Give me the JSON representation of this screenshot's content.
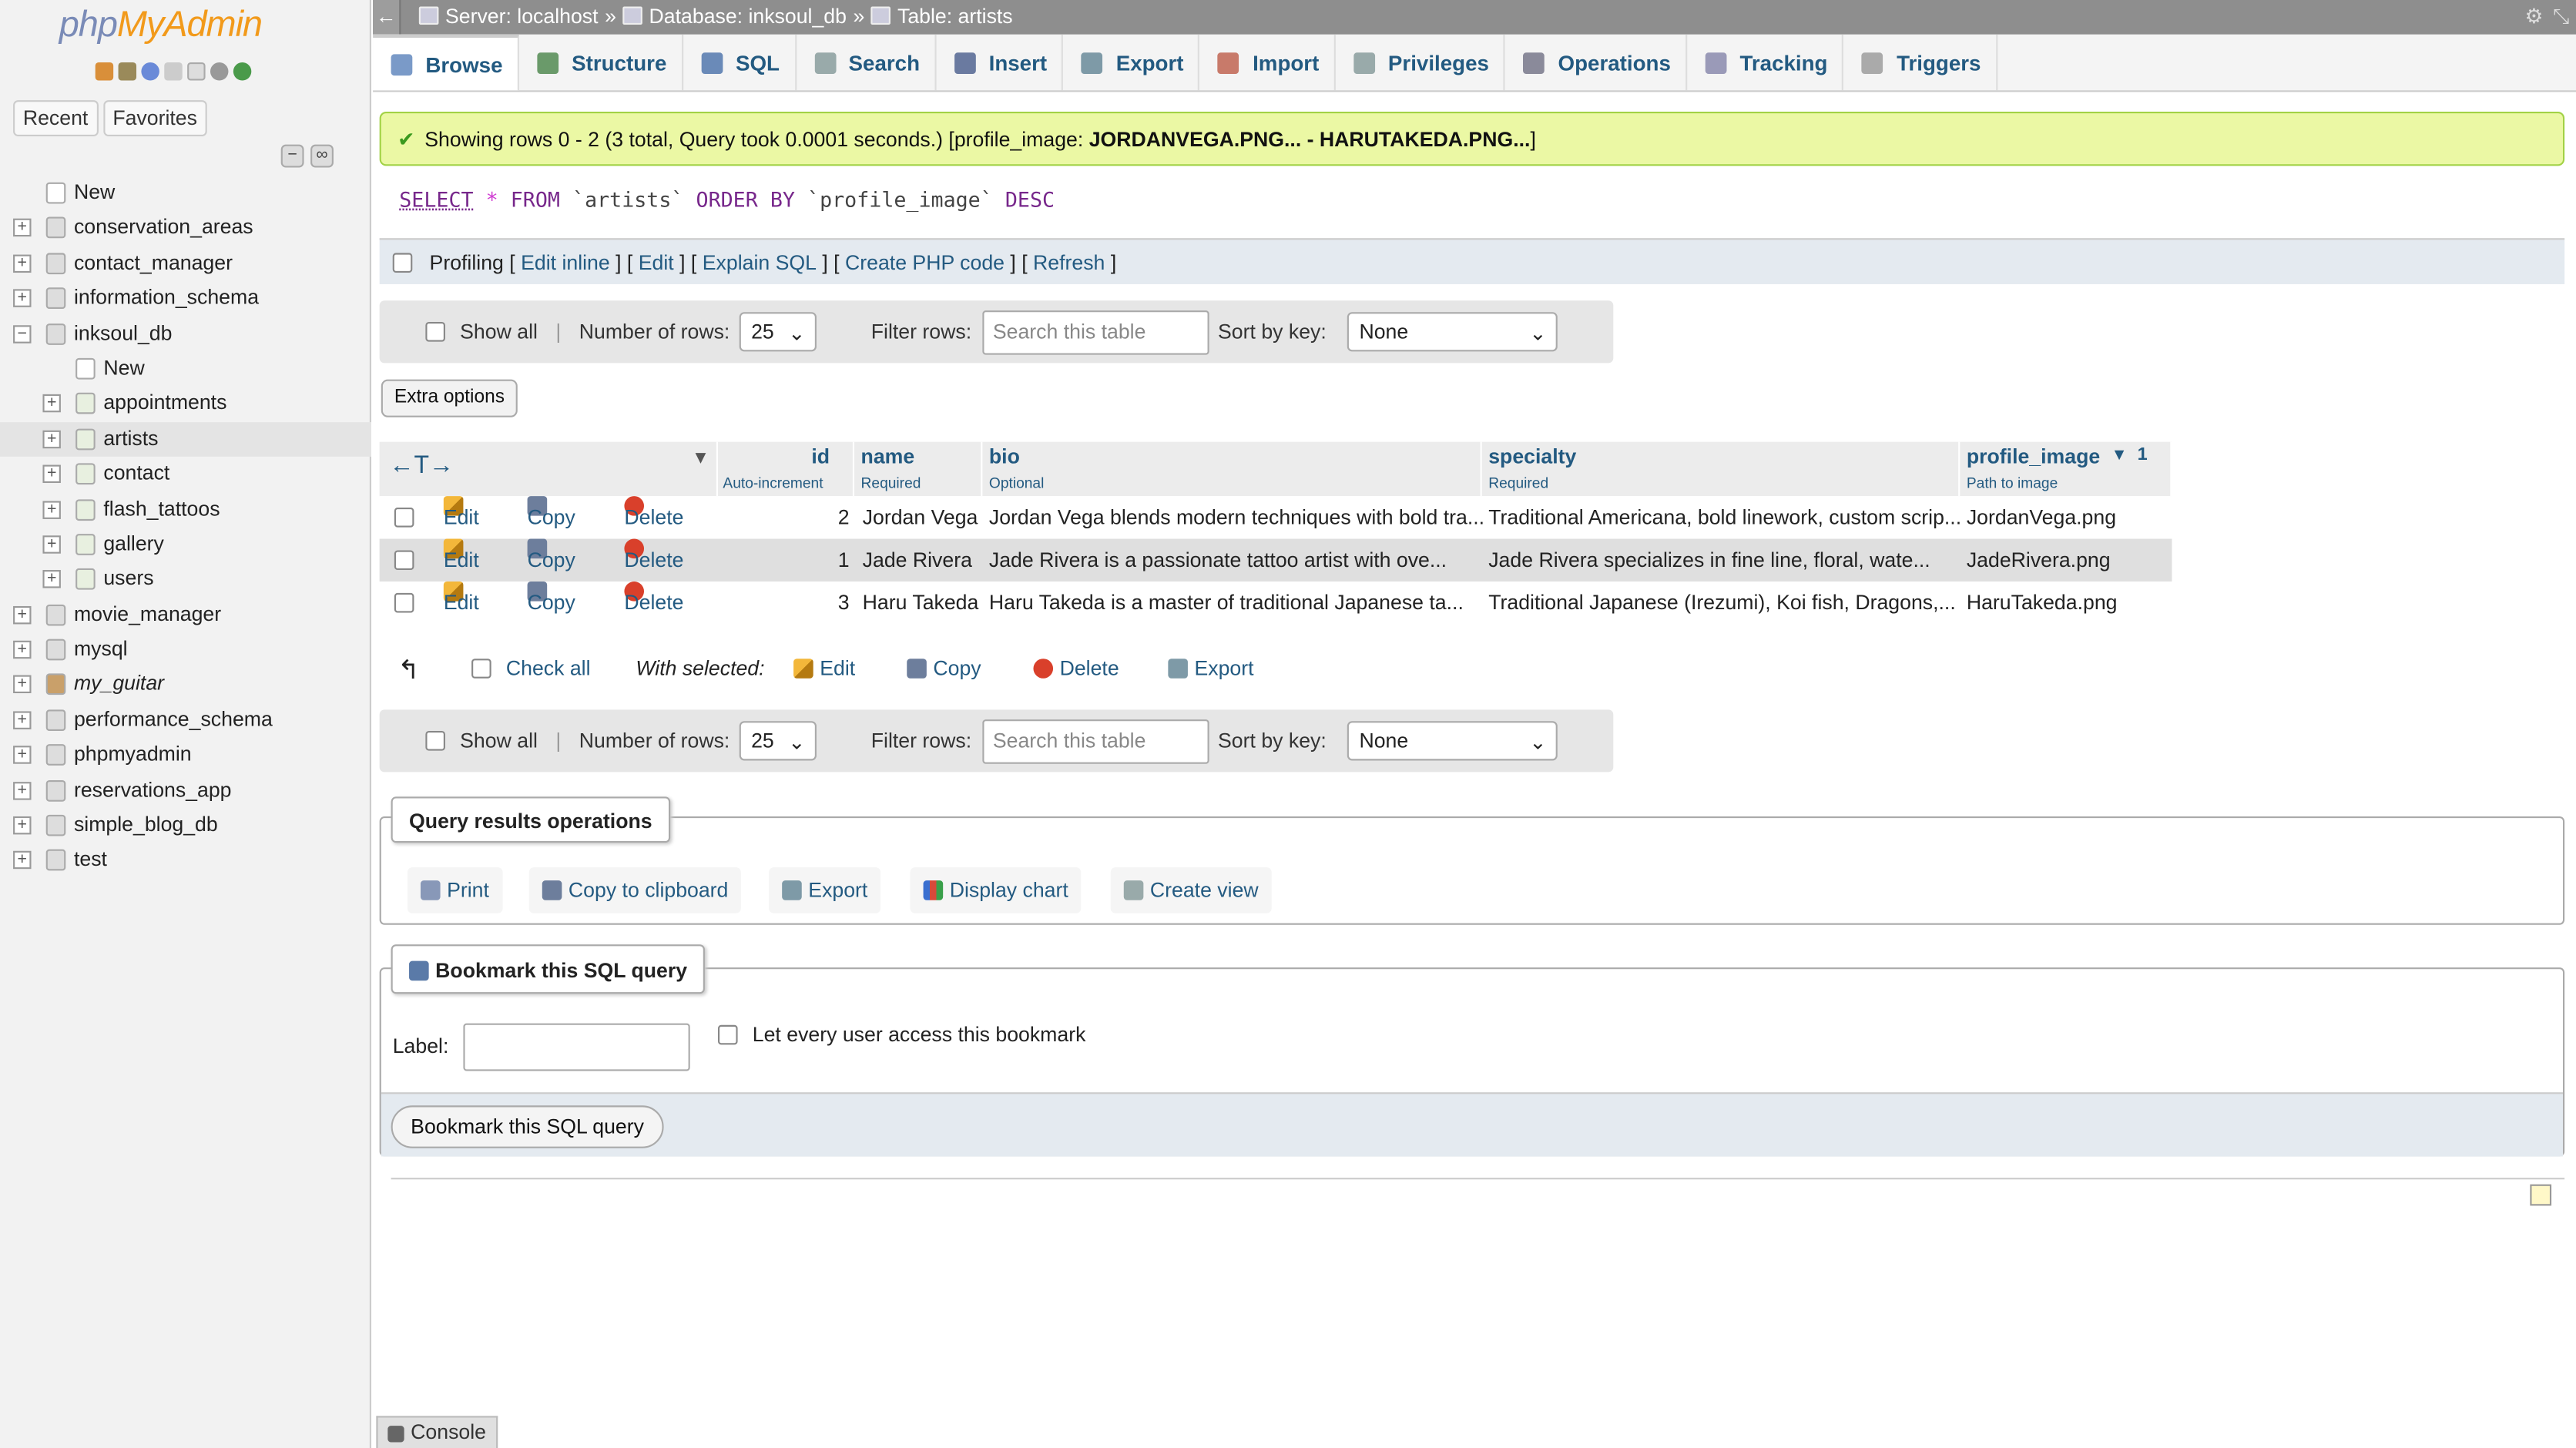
{
  "logo": {
    "part1": "php",
    "part2": "MyAdmin"
  },
  "nav": {
    "tab_recent": "Recent",
    "tab_favorites": "Favorites",
    "tree": [
      {
        "label": "New",
        "level": 0,
        "type": "new"
      },
      {
        "label": "conservation_areas",
        "level": 0,
        "type": "db"
      },
      {
        "label": "contact_manager",
        "level": 0,
        "type": "db"
      },
      {
        "label": "information_schema",
        "level": 0,
        "type": "db"
      },
      {
        "label": "inksoul_db",
        "level": 0,
        "type": "db",
        "expanded": true
      },
      {
        "label": "New",
        "level": 1,
        "type": "new"
      },
      {
        "label": "appointments",
        "level": 1,
        "type": "table"
      },
      {
        "label": "artists",
        "level": 1,
        "type": "table",
        "selected": true
      },
      {
        "label": "contact",
        "level": 1,
        "type": "table"
      },
      {
        "label": "flash_tattoos",
        "level": 1,
        "type": "table"
      },
      {
        "label": "gallery",
        "level": 1,
        "type": "table"
      },
      {
        "label": "users",
        "level": 1,
        "type": "table"
      },
      {
        "label": "movie_manager",
        "level": 0,
        "type": "db"
      },
      {
        "label": "mysql",
        "level": 0,
        "type": "db"
      },
      {
        "label": "my_guitar",
        "level": 0,
        "type": "db",
        "italic": true
      },
      {
        "label": "performance_schema",
        "level": 0,
        "type": "db"
      },
      {
        "label": "phpmyadmin",
        "level": 0,
        "type": "db"
      },
      {
        "label": "reservations_app",
        "level": 0,
        "type": "db"
      },
      {
        "label": "simple_blog_db",
        "level": 0,
        "type": "db"
      },
      {
        "label": "test",
        "level": 0,
        "type": "db"
      }
    ]
  },
  "breadcrumb": {
    "server": "Server: localhost",
    "database": "Database: inksoul_db",
    "table": "Table: artists",
    "sep": "»"
  },
  "tabs": [
    {
      "label": "Browse",
      "icon": "browse-icon",
      "active": true
    },
    {
      "label": "Structure",
      "icon": "structure-icon"
    },
    {
      "label": "SQL",
      "icon": "sql-icon"
    },
    {
      "label": "Search",
      "icon": "search-icon"
    },
    {
      "label": "Insert",
      "icon": "insert-icon"
    },
    {
      "label": "Export",
      "icon": "export-icon"
    },
    {
      "label": "Import",
      "icon": "import-icon"
    },
    {
      "label": "Privileges",
      "icon": "privileges-icon"
    },
    {
      "label": "Operations",
      "icon": "operations-icon"
    },
    {
      "label": "Tracking",
      "icon": "tracking-icon"
    },
    {
      "label": "Triggers",
      "icon": "triggers-icon"
    }
  ],
  "notice": {
    "text": "Showing rows 0 - 2 (3 total, Query took 0.0001 seconds.) [profile_image: ",
    "bold": "JORDANVEGA.PNG... - HARUTAKEDA.PNG...",
    "end": "]"
  },
  "sql": {
    "select": "SELECT",
    "star": "*",
    "from": "FROM",
    "table": "`artists`",
    "order": "ORDER BY",
    "col": "`profile_image`",
    "desc": "DESC"
  },
  "profiling": {
    "label": "Profiling",
    "edit_inline": "Edit inline",
    "edit": "Edit",
    "explain": "Explain SQL",
    "php": "Create PHP code",
    "refresh": "Refresh"
  },
  "navbar": {
    "show_all": "Show all",
    "num_rows_label": "Number of rows:",
    "num_rows": "25",
    "filter_label": "Filter rows:",
    "filter_placeholder": "Search this table",
    "sort_label": "Sort by key:",
    "sort_value": "None"
  },
  "extra_options": "Extra options",
  "columns": [
    {
      "name": "id",
      "sub": "Auto-increment"
    },
    {
      "name": "name",
      "sub": "Required"
    },
    {
      "name": "bio",
      "sub": "Optional"
    },
    {
      "name": "specialty",
      "sub": "Required"
    },
    {
      "name": "profile_image",
      "sub": "Path to image",
      "sort": "1"
    }
  ],
  "row_actions": {
    "edit": "Edit",
    "copy": "Copy",
    "delete": "Delete"
  },
  "rows": [
    {
      "id": "2",
      "name": "Jordan Vega",
      "bio": "Jordan Vega blends modern techniques with bold tra...",
      "specialty": "Traditional Americana, bold linework, custom scrip...",
      "profile_image": "JordanVega.png"
    },
    {
      "id": "1",
      "name": "Jade Rivera",
      "bio": "Jade Rivera is a passionate tattoo artist with ove...",
      "specialty": "Jade Rivera specializes in fine line, floral, wate...",
      "profile_image": "JadeRivera.png"
    },
    {
      "id": "3",
      "name": "Haru Takeda",
      "bio": "Haru Takeda is a master of traditional Japanese ta...",
      "specialty": "Traditional Japanese (Irezumi), Koi fish, Dragons,...",
      "profile_image": "HaruTakeda.png"
    }
  ],
  "with_selected": {
    "check_all": "Check all",
    "label": "With selected:",
    "edit": "Edit",
    "copy": "Copy",
    "delete": "Delete",
    "export": "Export"
  },
  "qro": {
    "title": "Query results operations",
    "print": "Print",
    "clipboard": "Copy to clipboard",
    "export": "Export",
    "chart": "Display chart",
    "view": "Create view"
  },
  "bookmark": {
    "title": "Bookmark this SQL query",
    "label": "Label:",
    "share": "Let every user access this bookmark",
    "button": "Bookmark this SQL query"
  },
  "console": "Console"
}
